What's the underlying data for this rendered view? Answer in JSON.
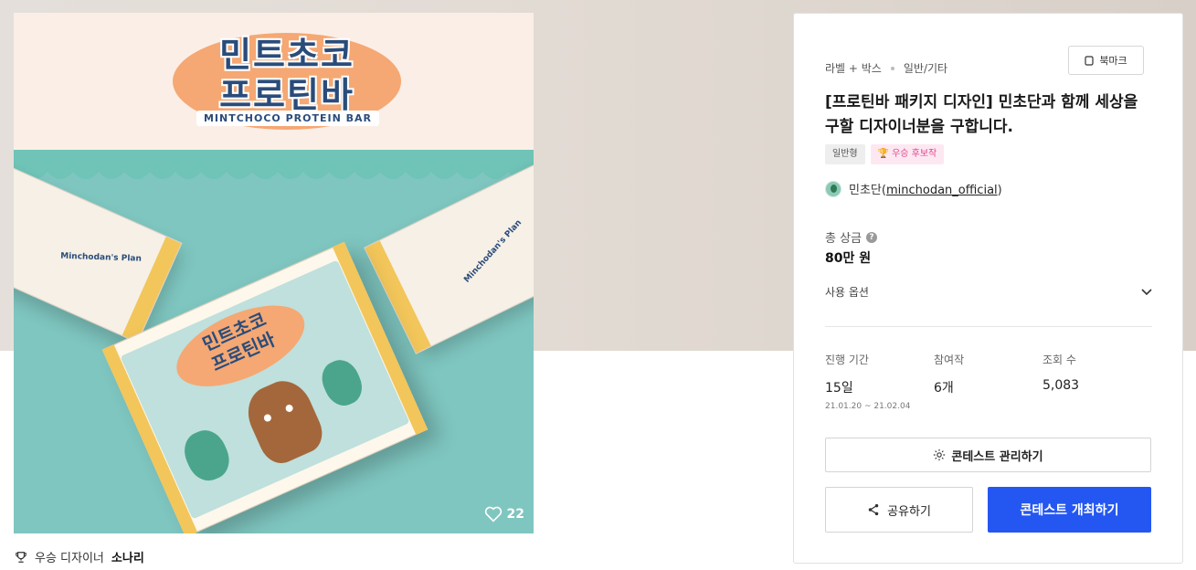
{
  "artwork": {
    "title_line1": "민트초코",
    "title_line2": "프로틴바",
    "subtitle": "MINTCHOCO PROTEIN BAR",
    "box_text": "Minchodan's Plan",
    "likes": "22",
    "icons": {
      "like": "heart-icon"
    }
  },
  "winner": {
    "label": "우승 디자이너",
    "name": "소나리",
    "icon": "trophy-icon"
  },
  "panel": {
    "breadcrumb": [
      "라벨 + 박스",
      "일반/기타"
    ],
    "bookmark_label": "북마크",
    "title": "[프로틴바 패키지 디자인] 민초단과 함께 세상을 구할 디자이너분을 구합니다.",
    "tags": {
      "type": "일반형",
      "badge": "우승 후보작"
    },
    "host": {
      "name": "민초단",
      "handle": "minchodan_official"
    },
    "prize_label": "총 상금",
    "prize_value": "80만 원",
    "options_label": "사용 옵션",
    "stats": {
      "period_label": "진행 기간",
      "period_value": "15일",
      "period_dates": "21.01.20 ~ 21.02.04",
      "entries_label": "참여작",
      "entries_value": "6개",
      "views_label": "조회 수",
      "views_value": "5,083"
    },
    "manage_label": "콘테스트 관리하기",
    "share_label": "공유하기",
    "host_label": "콘테스트 개최하기"
  },
  "colors": {
    "primary": "#2457f2",
    "badge_pink": "#e0468f",
    "mint": "#7fc6c0",
    "accent_orange": "#f5a873"
  }
}
